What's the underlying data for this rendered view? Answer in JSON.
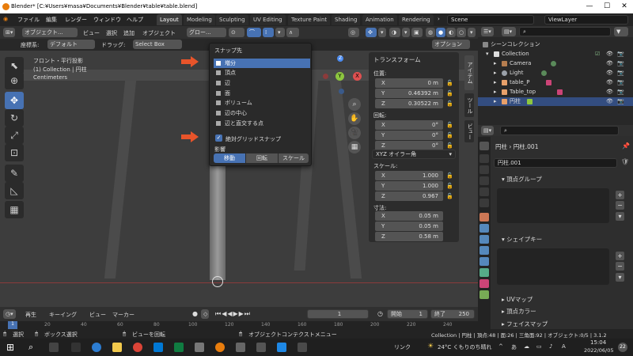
{
  "titlebar": {
    "title": "Blender* [C:¥Users¥masa¥Documents¥Blender¥table¥table.blend]",
    "minimize": "—",
    "maximize": "☐",
    "close": "✕"
  },
  "menubar": {
    "menus": [
      "ファイル",
      "編集",
      "レンダー",
      "ウィンドウ",
      "ヘルプ"
    ],
    "workspaces": [
      "Layout",
      "Modeling",
      "Sculpting",
      "UV Editing",
      "Texture Paint",
      "Shading",
      "Animation",
      "Rendering"
    ],
    "scene": "Scene",
    "view_layer": "ViewLayer"
  },
  "header": {
    "mode": "オブジェクト...",
    "menus": [
      "ビュー",
      "選択",
      "追加",
      "オブジェクト"
    ],
    "transform_orient": "グロー...",
    "coord_label": "座標系:",
    "coord_value": "デフォルト",
    "drag_label": "ドラッグ:",
    "select_box": "Select Box",
    "options": "オプション"
  },
  "viewport": {
    "view_name": "フロント・平行投影",
    "collection_info": "(1) Collection | 円柱",
    "units": "Centimeters",
    "gizmo_z": "Z",
    "gizmo_y": "Y",
    "gizmo_x": "X"
  },
  "snap_popup": {
    "title": "スナップ先",
    "items": [
      "増分",
      "頂点",
      "辺",
      "面",
      "ボリューム",
      "辺の中心",
      "辺と直交する点"
    ],
    "absolute_grid": "絶対グリッドスナップ",
    "affect_label": "影響",
    "affect": [
      "移動",
      "回転",
      "スケール"
    ]
  },
  "transform": {
    "title": "トランスフォーム",
    "location_label": "位置:",
    "location": [
      {
        "axis": "X",
        "value": "0 m"
      },
      {
        "axis": "Y",
        "value": "0.46392 m"
      },
      {
        "axis": "Z",
        "value": "0.30522 m"
      }
    ],
    "rotation_label": "回転:",
    "rotation": [
      {
        "axis": "X",
        "value": "0°"
      },
      {
        "axis": "Y",
        "value": "0°"
      },
      {
        "axis": "Z",
        "value": "0°"
      }
    ],
    "rotation_mode": "XYZ オイラー角",
    "scale_label": "スケール:",
    "scale": [
      {
        "axis": "X",
        "value": "1.000"
      },
      {
        "axis": "Y",
        "value": "1.000"
      },
      {
        "axis": "Z",
        "value": "0.967"
      }
    ],
    "dims_label": "寸法:",
    "dims": [
      {
        "axis": "X",
        "value": "0.05 m"
      },
      {
        "axis": "Y",
        "value": "0.05 m"
      },
      {
        "axis": "Z",
        "value": "0.58 m"
      }
    ]
  },
  "sidetabs": [
    "アイテム",
    "ツール",
    "ビュー"
  ],
  "outliner": {
    "scene_collection": "シーンコレクション",
    "collection": "Collection",
    "objects": [
      "Camera",
      "Light",
      "table_P",
      "Table_top",
      "円柱"
    ],
    "colors": {
      "camera": "#b57d4f",
      "light": "#9aa0a8",
      "mesh": "#e8a06a"
    }
  },
  "properties": {
    "breadcrumb_obj": "円柱",
    "breadcrumb_mesh": "円柱.001",
    "mesh_name": "円柱.001",
    "sections": [
      "頂点グループ",
      "シェイプキー",
      "UVマップ",
      "頂点カラー",
      "フェイスマップ"
    ]
  },
  "timeline": {
    "playback": "再生",
    "keying": "キーイング",
    "view": "ビュー",
    "marker": "マーカー",
    "current_frame": "1",
    "start_label": "開始",
    "start": "1",
    "end_label": "終了",
    "end": "250",
    "ticks": [
      "1",
      "20",
      "40",
      "60",
      "80",
      "100",
      "120",
      "140",
      "160",
      "180",
      "200",
      "220",
      "240"
    ]
  },
  "statusbar": {
    "select": "選択",
    "box_select": "ボックス選択",
    "rotate_view": "ビューを回転",
    "context_menu": "オブジェクトコンテクストメニュー",
    "stats": "Collection | 円柱 | 頂点:48 | 面:26 | 三角面:92 | オブジェクト:0/5 | 3.1.2"
  },
  "taskbar": {
    "search_icon": "⌕",
    "link": "リンク",
    "weather": "24°C くもりのち晴れ",
    "time": "15:04",
    "date": "2022/06/05",
    "notif": "22"
  },
  "colors": {
    "accent": "#4772b3",
    "arrow": "#e8542a",
    "axis_x": "#e05050",
    "axis_y": "#8dc63f",
    "axis_z": "#4c8cf0"
  }
}
